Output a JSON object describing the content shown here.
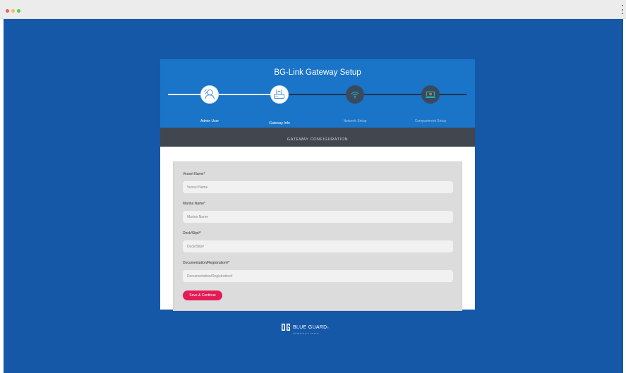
{
  "page": {
    "title": "BG-Link Gateway Setup",
    "section_title": "GATEWAY CONFIGURATION"
  },
  "steps": [
    {
      "label": "Admin User",
      "icon": "user-icon",
      "state": "complete"
    },
    {
      "label": "Gateway Info",
      "icon": "router-icon",
      "state": "active"
    },
    {
      "label": "Network Setup",
      "icon": "wifi-icon",
      "state": "pending"
    },
    {
      "label": "Compartment Setup",
      "icon": "compartment-icon",
      "state": "pending"
    }
  ],
  "form": {
    "fields": [
      {
        "label": "Vessel Name*",
        "placeholder": "Vessel Name",
        "value": ""
      },
      {
        "label": "Marina Name*",
        "placeholder": "Marina Name",
        "value": ""
      },
      {
        "label": "Dock/Slip#*",
        "placeholder": "Dock/Slip#",
        "value": ""
      },
      {
        "label": "Documentation/Registration#*",
        "placeholder": "Documentation/Registration#",
        "value": ""
      }
    ],
    "submit_label": "Save & Continue"
  },
  "footer": {
    "brand_name": "BLUE GUARD",
    "brand_mark": "®",
    "brand_sub": "INNOVATIONS"
  },
  "colors": {
    "background": "#1558a8",
    "header": "#1a74c7",
    "section_bar": "#41474f",
    "accent_button": "#e31c56"
  }
}
